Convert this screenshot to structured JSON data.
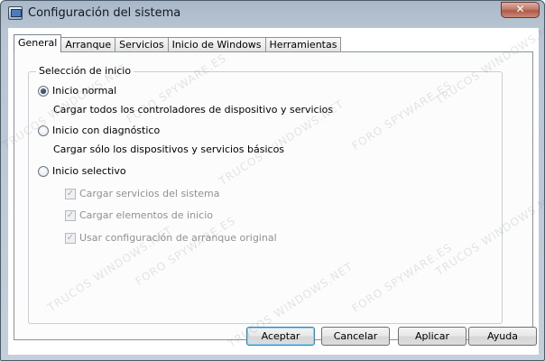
{
  "window": {
    "title": "Configuración del sistema",
    "close_glyph": "✕"
  },
  "tabs": [
    {
      "label": "General",
      "active": true
    },
    {
      "label": "Arranque",
      "active": false
    },
    {
      "label": "Servicios",
      "active": false
    },
    {
      "label": "Inicio de Windows",
      "active": false
    },
    {
      "label": "Herramientas",
      "active": false
    }
  ],
  "startup": {
    "group_label": "Selección de inicio",
    "normal": {
      "label": "Inicio normal",
      "description": "Cargar todos los controladores de dispositivo y servicios",
      "selected": true
    },
    "diagnostic": {
      "label": "Inicio con diagnóstico",
      "description": "Cargar sólo los dispositivos y servicios básicos",
      "selected": false
    },
    "selective": {
      "label": "Inicio selectivo",
      "selected": false,
      "options": [
        {
          "label": "Cargar servicios del sistema",
          "checked": true,
          "enabled": false
        },
        {
          "label": "Cargar elementos de inicio",
          "checked": true,
          "enabled": false
        },
        {
          "label": "Usar configuración de arranque original",
          "checked": true,
          "enabled": false
        }
      ]
    }
  },
  "buttons": {
    "accept": "Aceptar",
    "cancel": "Cancelar",
    "apply": "Aplicar",
    "help": "Ayuda"
  },
  "watermark": {
    "text_a": "TRUCOS WINDOWS.NET",
    "text_b": "FORO SPYWARE.ES"
  }
}
